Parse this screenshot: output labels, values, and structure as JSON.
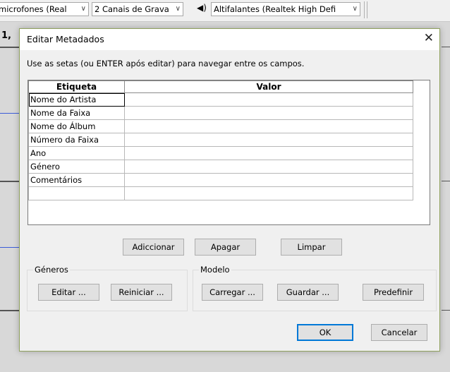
{
  "toolbar": {
    "mic_combo": "microfones (Real",
    "channels_combo": "2 Canais de Grava",
    "speaker_combo": "Altifalantes (Realtek High Defi",
    "speaker_glyph": "◀)"
  },
  "track": {
    "number": "1,"
  },
  "dialog": {
    "title": "Editar Metadados",
    "close_glyph": "✕",
    "hint": "Use as setas (ou ENTER após editar) para navegar entre os campos.",
    "table": {
      "headers": [
        "Etiqueta",
        "Valor"
      ],
      "rows": [
        {
          "label": "Nome do Artista",
          "value": ""
        },
        {
          "label": "Nome da Faixa",
          "value": ""
        },
        {
          "label": "Nome do Álbum",
          "value": ""
        },
        {
          "label": "Número da Faixa",
          "value": ""
        },
        {
          "label": "Ano",
          "value": ""
        },
        {
          "label": "Género",
          "value": ""
        },
        {
          "label": "Comentários",
          "value": ""
        },
        {
          "label": "",
          "value": ""
        }
      ]
    },
    "buttons": {
      "add": "Adiccionar",
      "delete": "Apagar",
      "clear": "Limpar",
      "ok": "OK",
      "cancel": "Cancelar"
    },
    "genres": {
      "label": "Géneros",
      "edit": "Editar ...",
      "reset": "Reiniciar ..."
    },
    "template": {
      "label": "Modelo",
      "load": "Carregar ...",
      "save": "Guardar ...",
      "set_default": "Predefinir"
    }
  },
  "colors": {
    "dialog_border": "#8fa15e",
    "ok_border": "#0078d7"
  }
}
